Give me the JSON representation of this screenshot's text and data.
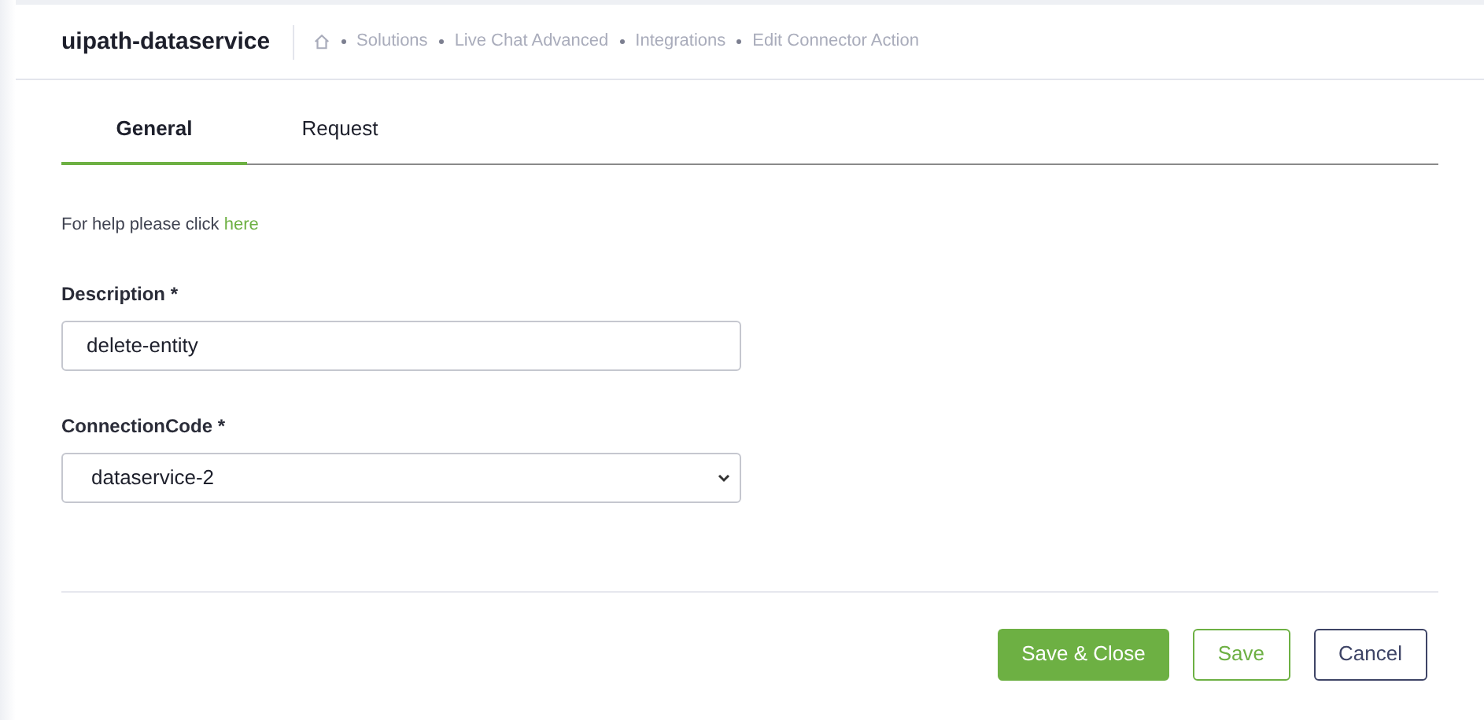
{
  "header": {
    "title": "uipath-dataservice",
    "breadcrumbs": [
      "Solutions",
      "Live Chat Advanced",
      "Integrations",
      "Edit Connector Action"
    ]
  },
  "tabs": [
    {
      "label": "General",
      "selected": true
    },
    {
      "label": "Request",
      "selected": false
    }
  ],
  "help": {
    "text": "For help please click",
    "link": "here"
  },
  "fields": [
    {
      "kind": "text",
      "label": "Description *",
      "value": "delete-entity"
    },
    {
      "kind": "select",
      "label": "ConnectionCode *",
      "value": "dataservice-2"
    }
  ],
  "buttons": [
    {
      "kind": "primary",
      "label": "Save & Close"
    },
    {
      "kind": "outline",
      "label": "Save"
    },
    {
      "kind": "secondary",
      "label": "Cancel"
    }
  ]
}
